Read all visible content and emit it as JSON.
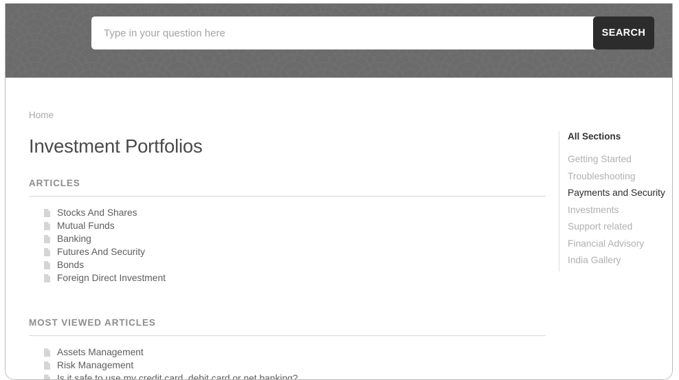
{
  "search": {
    "placeholder": "Type in your question here",
    "value": "",
    "button_label": "SEARCH"
  },
  "breadcrumb": {
    "label": "Home"
  },
  "page_title": "Investment Portfolios",
  "sections": [
    {
      "heading": "ARTICLES",
      "items": [
        "Stocks And Shares",
        "Mutual Funds",
        "Banking",
        "Futures And Security",
        "Bonds",
        "Foreign Direct Investment"
      ]
    },
    {
      "heading": "MOST VIEWED ARTICLES",
      "items": [
        "Assets Management",
        "Risk Management",
        "Is it safe to use my credit card, debit card or net banking?"
      ]
    }
  ],
  "sidebar": {
    "heading": "All Sections",
    "items": [
      {
        "label": "Getting Started",
        "active": false
      },
      {
        "label": "Troubleshooting",
        "active": false
      },
      {
        "label": "Payments and Security",
        "active": true
      },
      {
        "label": "Investments",
        "active": false
      },
      {
        "label": "Support related",
        "active": false
      },
      {
        "label": "Financial Advisory",
        "active": false
      },
      {
        "label": "India Gallery",
        "active": false
      }
    ]
  },
  "icons": {
    "article": "document-icon"
  },
  "colors": {
    "header_background": "#6b6b6b",
    "header_pattern": "#727272",
    "search_button": "#2c2c2c",
    "title_text": "#4a4a4a",
    "muted_text": "#b0b0b0",
    "active_text": "#2b2b2b",
    "divider": "#d8d8d8"
  }
}
